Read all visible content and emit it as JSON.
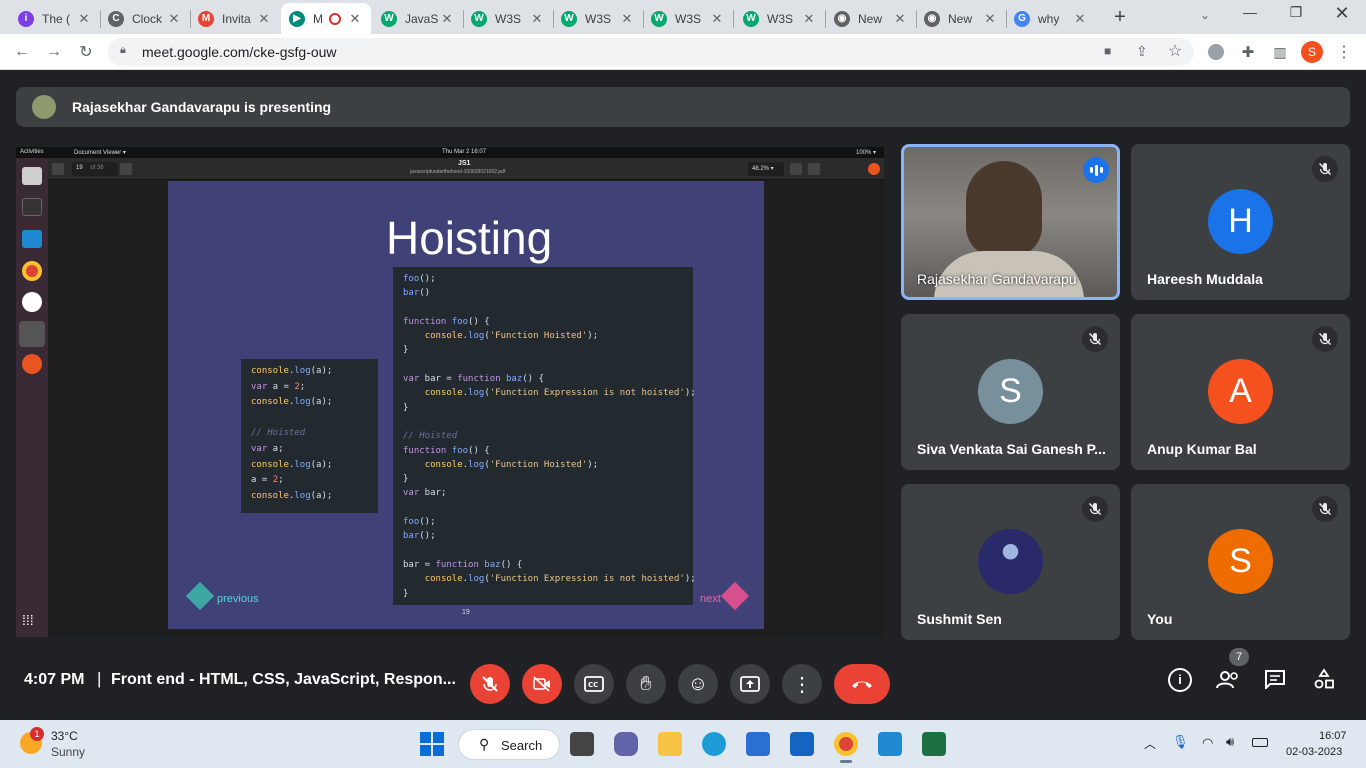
{
  "tabs": [
    {
      "title": "The (",
      "fav_color": "#7b3fe4",
      "fav_glyph": "i"
    },
    {
      "title": "Clock",
      "fav_color": "#5f6368",
      "fav_glyph": "C"
    },
    {
      "title": "Invita",
      "fav_color": "#ea4335",
      "fav_glyph": "M"
    },
    {
      "title": "M",
      "fav_color": "#00897b",
      "fav_glyph": "▶",
      "active": true
    },
    {
      "title": "JavaS",
      "fav_color": "#04aa6d",
      "fav_glyph": "W"
    },
    {
      "title": "W3S",
      "fav_color": "#04aa6d",
      "fav_glyph": "W"
    },
    {
      "title": "W3S",
      "fav_color": "#04aa6d",
      "fav_glyph": "W"
    },
    {
      "title": "W3S",
      "fav_color": "#04aa6d",
      "fav_glyph": "W"
    },
    {
      "title": "W3S",
      "fav_color": "#04aa6d",
      "fav_glyph": "W"
    },
    {
      "title": "New",
      "fav_color": "#5f6368",
      "fav_glyph": "◉"
    },
    {
      "title": "New",
      "fav_color": "#5f6368",
      "fav_glyph": "◉"
    },
    {
      "title": "why",
      "fav_color": "#4285f4",
      "fav_glyph": "G"
    }
  ],
  "url": "meet.google.com/cke-gsfg-ouw",
  "profile_initial": "S",
  "presenting_text": "Rajasekhar Gandavarapu is presenting",
  "share": {
    "activities": "Activities",
    "app_menu": "Document Viewer ▾",
    "clock": "Thu Mar 2  16:07",
    "doc_title": "JS1",
    "doc_file": "javascriptunderthehood-160629021002.pdf",
    "page_num": "19",
    "page_of": "of 36",
    "zoom": "48.2% ▾",
    "battery": "100% ▾",
    "slide_title": "Hoisting",
    "prev_label": "previous",
    "next_label": "next",
    "page_footer": "19"
  },
  "code_left": [
    [
      [
        "yl",
        "console"
      ],
      [
        "pl",
        "."
      ],
      [
        "fn",
        "log"
      ],
      [
        "pl",
        "(a);"
      ]
    ],
    [
      [
        "kw",
        "var"
      ],
      [
        "pl",
        " a = "
      ],
      [
        "nu",
        "2"
      ],
      [
        "pl",
        ";"
      ]
    ],
    [
      [
        "yl",
        "console"
      ],
      [
        "pl",
        "."
      ],
      [
        "fn",
        "log"
      ],
      [
        "pl",
        "(a);"
      ]
    ],
    [
      [
        "pl",
        ""
      ]
    ],
    [
      [
        "cm",
        "// Hoisted"
      ]
    ],
    [
      [
        "kw",
        "var"
      ],
      [
        "pl",
        " a;"
      ]
    ],
    [
      [
        "yl",
        "console"
      ],
      [
        "pl",
        "."
      ],
      [
        "fn",
        "log"
      ],
      [
        "pl",
        "(a);"
      ]
    ],
    [
      [
        "pl",
        "a = "
      ],
      [
        "nu",
        "2"
      ],
      [
        "pl",
        ";"
      ]
    ],
    [
      [
        "yl",
        "console"
      ],
      [
        "pl",
        "."
      ],
      [
        "fn",
        "log"
      ],
      [
        "pl",
        "(a);"
      ]
    ]
  ],
  "code_right": [
    [
      [
        "fn",
        "foo"
      ],
      [
        "pl",
        "();"
      ]
    ],
    [
      [
        "fn",
        "bar"
      ],
      [
        "pl",
        "()"
      ]
    ],
    [
      [
        "pl",
        ""
      ]
    ],
    [
      [
        "kw",
        "function"
      ],
      [
        "pl",
        " "
      ],
      [
        "fn",
        "foo"
      ],
      [
        "pl",
        "() {"
      ]
    ],
    [
      [
        "pl",
        "    "
      ],
      [
        "yl",
        "console"
      ],
      [
        "pl",
        "."
      ],
      [
        "fn",
        "log"
      ],
      [
        "pl",
        "("
      ],
      [
        "st",
        "'Function Hoisted'"
      ],
      [
        "pl",
        ");"
      ]
    ],
    [
      [
        "pl",
        "}"
      ]
    ],
    [
      [
        "pl",
        ""
      ]
    ],
    [
      [
        "kw",
        "var"
      ],
      [
        "pl",
        " bar = "
      ],
      [
        "kw",
        "function"
      ],
      [
        "pl",
        " "
      ],
      [
        "fn",
        "baz"
      ],
      [
        "pl",
        "() {"
      ]
    ],
    [
      [
        "pl",
        "    "
      ],
      [
        "yl",
        "console"
      ],
      [
        "pl",
        "."
      ],
      [
        "fn",
        "log"
      ],
      [
        "pl",
        "("
      ],
      [
        "st",
        "'Function Expression is not hoisted'"
      ],
      [
        "pl",
        ");"
      ]
    ],
    [
      [
        "pl",
        "}"
      ]
    ],
    [
      [
        "pl",
        ""
      ]
    ],
    [
      [
        "cm",
        "// Hoisted"
      ]
    ],
    [
      [
        "kw",
        "function"
      ],
      [
        "pl",
        " "
      ],
      [
        "fn",
        "foo"
      ],
      [
        "pl",
        "() {"
      ]
    ],
    [
      [
        "pl",
        "    "
      ],
      [
        "yl",
        "console"
      ],
      [
        "pl",
        "."
      ],
      [
        "fn",
        "log"
      ],
      [
        "pl",
        "("
      ],
      [
        "st",
        "'Function Hoisted'"
      ],
      [
        "pl",
        ");"
      ]
    ],
    [
      [
        "pl",
        "}"
      ]
    ],
    [
      [
        "kw",
        "var"
      ],
      [
        "pl",
        " bar;"
      ]
    ],
    [
      [
        "pl",
        ""
      ]
    ],
    [
      [
        "fn",
        "foo"
      ],
      [
        "pl",
        "();"
      ]
    ],
    [
      [
        "fn",
        "bar"
      ],
      [
        "pl",
        "();"
      ]
    ],
    [
      [
        "pl",
        ""
      ]
    ],
    [
      [
        "pl",
        "bar = "
      ],
      [
        "kw",
        "function"
      ],
      [
        "pl",
        " "
      ],
      [
        "fn",
        "baz"
      ],
      [
        "pl",
        "() {"
      ]
    ],
    [
      [
        "pl",
        "    "
      ],
      [
        "yl",
        "console"
      ],
      [
        "pl",
        "."
      ],
      [
        "fn",
        "log"
      ],
      [
        "pl",
        "("
      ],
      [
        "st",
        "'Function Expression is not hoisted'"
      ],
      [
        "pl",
        ");"
      ]
    ],
    [
      [
        "pl",
        "}"
      ]
    ]
  ],
  "participants": [
    {
      "name": "Rajasekhar Gandavarapu",
      "initial": "",
      "color": "#6b6b6b",
      "speaking": true
    },
    {
      "name": "Hareesh Muddala",
      "initial": "H",
      "color": "#1a73e8"
    },
    {
      "name": "Siva Venkata Sai Ganesh P...",
      "initial": "S",
      "color": "#78909c"
    },
    {
      "name": "Anup Kumar Bal",
      "initial": "A",
      "color": "#f4511e"
    },
    {
      "name": "Sushmit Sen",
      "initial": "",
      "color": "#2a2a6a"
    },
    {
      "name": "You",
      "initial": "S",
      "color": "#ef6c00"
    }
  ],
  "meeting": {
    "time": "4:07 PM",
    "divider": "|",
    "title": "Front end - HTML, CSS, JavaScript, Respon...",
    "people_count": "7"
  },
  "taskbar": {
    "temp": "33°C",
    "weather": "Sunny",
    "weather_badge": "1",
    "search_label": "Search",
    "time": "16:07",
    "date": "02-03-2023"
  }
}
